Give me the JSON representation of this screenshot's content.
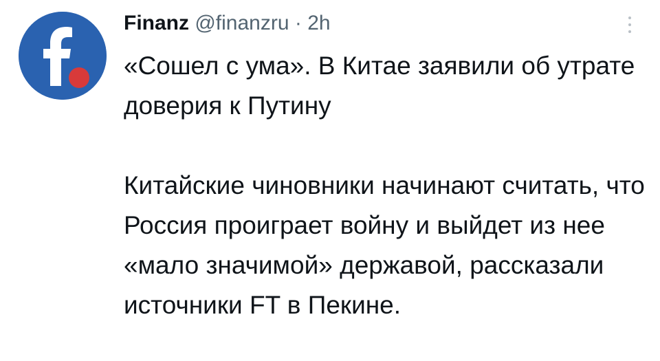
{
  "tweet": {
    "author": {
      "name": "Finanz",
      "handle": "@finanzru",
      "avatar_icon": "finanz-logo-icon"
    },
    "separator": "·",
    "time": "2h",
    "more_icon": "more-vertical-icon",
    "text": {
      "headline": "«Сошел с ума». В Китае заявили об утрате доверия к Путину",
      "body": "Китайские чиновники начинают считать, что Россия проиграет войну и выйдет из нее «мало значимой» державой, рассказали источники FT в Пекине."
    }
  },
  "colors": {
    "avatar_blue": "#2a62b0",
    "avatar_dot": "#d83a3a",
    "text": "#0f1419",
    "muted": "#536471"
  }
}
